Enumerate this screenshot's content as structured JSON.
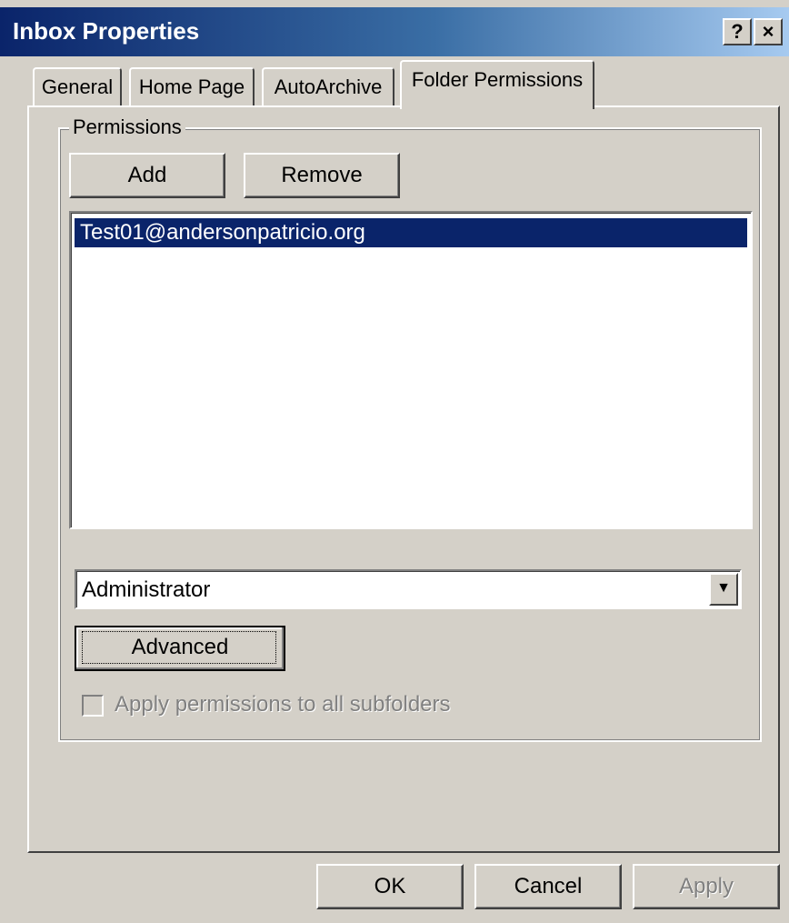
{
  "window": {
    "title": "Inbox Properties",
    "help_glyph": "?",
    "close_glyph": "×"
  },
  "tabs": [
    {
      "label": "General",
      "active": false
    },
    {
      "label": "Home Page",
      "active": false
    },
    {
      "label": "AutoArchive",
      "active": false
    },
    {
      "label": "Folder Permissions",
      "active": true
    }
  ],
  "permissions": {
    "group_label": "Permissions",
    "add_label": "Add",
    "remove_label": "Remove",
    "list_items": [
      "Test01@andersonpatricio.org"
    ],
    "selected_index": 0,
    "role_selected": "Administrator",
    "combo_arrow_glyph": "▼",
    "advanced_label": "Advanced",
    "apply_subfolders_label": "Apply permissions to all subfolders",
    "apply_subfolders_checked": false,
    "apply_subfolders_enabled": false
  },
  "footer": {
    "ok_label": "OK",
    "cancel_label": "Cancel",
    "apply_label": "Apply",
    "apply_enabled": false
  },
  "colors": {
    "face": "#d4d0c8",
    "title_start": "#0a246a",
    "selection": "#0a246a"
  },
  "icons": {
    "help": "help-icon",
    "close": "close-icon",
    "dropdown": "chevron-down-icon"
  }
}
